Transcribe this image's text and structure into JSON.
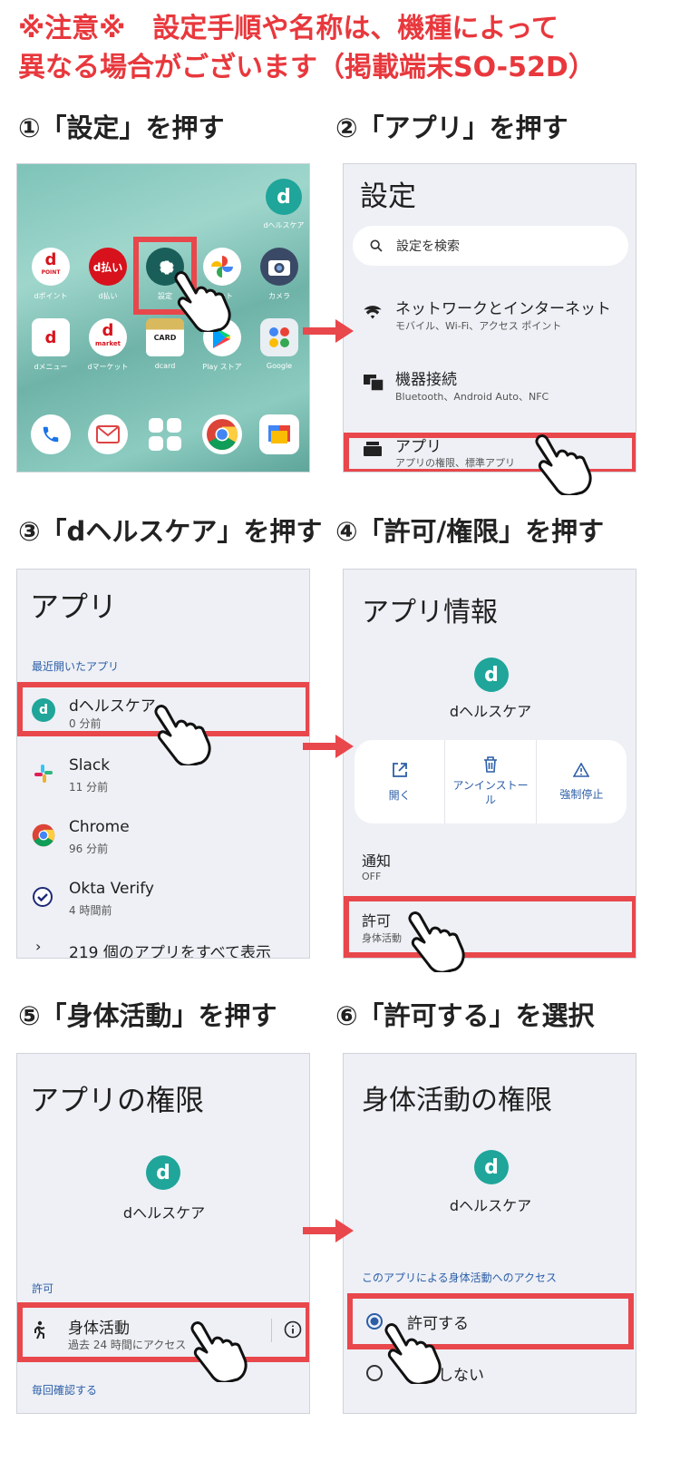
{
  "notice": {
    "line1": "※注意※　設定手順や名称は、機種によって",
    "line2": "異なる場合がございます（掲載端末SO-52D）"
  },
  "steps": {
    "s1": "①「設定」を押す",
    "s2": "②「アプリ」を押す",
    "s3": "③「dヘルスケア」を押す",
    "s4": "④「許可/権限」を押す",
    "s5": "⑤「身体活動」を押す",
    "s6": "⑥「許可する」を選択"
  },
  "home": {
    "top_app": "dヘルスケア",
    "row1": [
      {
        "icon": "d",
        "label": "dポイント"
      },
      {
        "icon": "d払い",
        "label": "d払い"
      },
      {
        "icon": "gear-icon",
        "label": "設定"
      },
      {
        "icon": "photos-icon",
        "label": "フォト"
      },
      {
        "icon": "camera-icon",
        "label": "カメラ"
      }
    ],
    "row2": [
      {
        "icon": "d",
        "label": "dメニュー"
      },
      {
        "icon": "d",
        "label": "dマーケット"
      },
      {
        "icon": "CARD",
        "label": "dcard"
      },
      {
        "icon": "play-icon",
        "label": "Play ストア"
      },
      {
        "icon": "google-icon",
        "label": "Google"
      }
    ],
    "dock": [
      "phone-icon",
      "mail-icon",
      "apps-icon",
      "chrome-icon",
      "news-icon"
    ],
    "icon_text": {
      "dpoint": "d",
      "dpoint_small": "POINT",
      "dbarai": "d払い",
      "dmarket": "market",
      "dcard": "CARD",
      "hc_logo": "d"
    }
  },
  "settings": {
    "title": "設定",
    "search_placeholder": "設定を検索",
    "items": [
      {
        "title": "ネットワークとインターネット",
        "sub": "モバイル、Wi-Fi、アクセス ポイント",
        "icon": "wifi-icon"
      },
      {
        "title": "機器接続",
        "sub": "Bluetooth、Android Auto、NFC",
        "icon": "devices-icon"
      },
      {
        "title": "アプリ",
        "sub": "アプリの権限、標準アプリ",
        "icon": "apps-box-icon"
      }
    ]
  },
  "apps": {
    "title": "アプリ",
    "recent_label": "最近開いたアプリ",
    "items": [
      {
        "name": "dヘルスケア",
        "time": "0 分前"
      },
      {
        "name": "Slack",
        "time": "11 分前"
      },
      {
        "name": "Chrome",
        "time": "96 分前"
      },
      {
        "name": "Okta Verify",
        "time": "4 時間前"
      }
    ],
    "see_all": "219 個のアプリをすべて表示"
  },
  "app_info": {
    "title": "アプリ情報",
    "app_name": "dヘルスケア",
    "actions": [
      {
        "label": "開く",
        "icon": "open-icon"
      },
      {
        "label": "アンインストール",
        "icon": "trash-icon"
      },
      {
        "label": "強制停止",
        "icon": "warning-icon"
      }
    ],
    "notify_label": "通知",
    "notify_value": "OFF",
    "perm_label": "許可",
    "perm_value": "身体活動"
  },
  "app_perms": {
    "title": "アプリの権限",
    "app_name": "dヘルスケア",
    "section": "許可",
    "item_title": "身体活動",
    "item_sub": "過去 24 時間にアクセス",
    "footer": "毎回確認する"
  },
  "activity_perm": {
    "title": "身体活動の権限",
    "app_name": "dヘルスケア",
    "section": "このアプリによる身体活動へのアクセス",
    "option_allow": "許可する",
    "option_deny": "許可しない"
  },
  "colors": {
    "highlight": "#e8474c",
    "notice": "#e8383d",
    "accent": "#2c5ea8",
    "brand_teal": "#1fa59a"
  }
}
